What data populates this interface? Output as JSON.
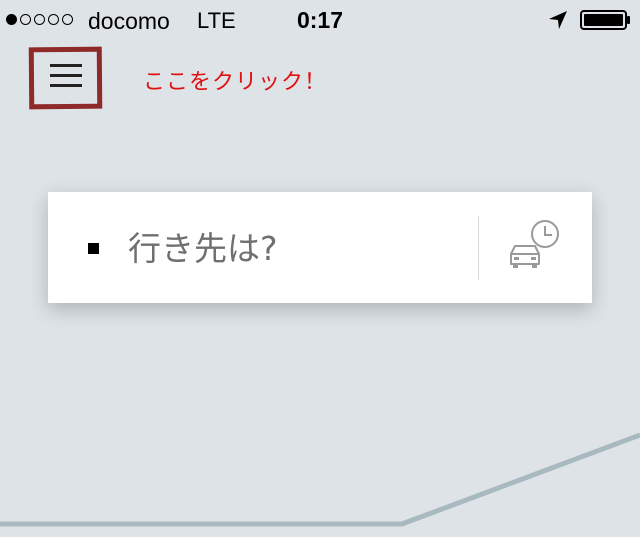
{
  "status_bar": {
    "carrier": "docomo",
    "network": "LTE",
    "time": "0:17",
    "signal_strength": 1,
    "signal_max": 5
  },
  "annotation": {
    "text": "ここをクリック！",
    "color": "#e01010"
  },
  "search": {
    "placeholder": "行き先は?"
  },
  "icons": {
    "menu": "hamburger-menu-icon",
    "destination_marker": "square-icon",
    "schedule": "car-clock-icon",
    "location": "location-arrow-icon",
    "battery": "battery-icon"
  },
  "colors": {
    "map_background": "#dee3e7",
    "highlight_border": "#8e2a2a",
    "route_line": "#a9b9c0"
  }
}
